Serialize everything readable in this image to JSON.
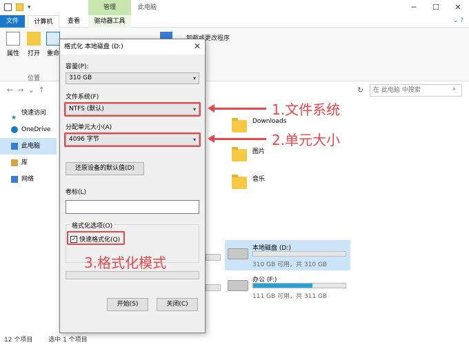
{
  "explorer": {
    "title": "此电脑",
    "contextual_tab": "管理",
    "ribbon_tabs": [
      "文件",
      "计算机",
      "查看",
      "驱动器工具"
    ],
    "ribbon_buttons": [
      "属性",
      "打开",
      "重命"
    ],
    "ribbon_group": "位置",
    "ribbon_right_text": "卸载或更改程序",
    "ribbon_right_text2": "性",
    "search_placeholder": "在 此电脑 中搜索",
    "nav_items": [
      {
        "label": "快速访问"
      },
      {
        "label": "OneDrive"
      },
      {
        "label": "此电脑"
      },
      {
        "label": "库"
      },
      {
        "label": "网络"
      }
    ],
    "folders": [
      {
        "label": "Downloads"
      },
      {
        "label": "图片"
      },
      {
        "label": "音乐"
      }
    ],
    "drives": [
      {
        "name": "本地磁盘 (D:)",
        "size": "310 GB 可用，共 310 GB",
        "used_fraction": 0.0
      },
      {
        "name": "办公 (F:)",
        "size": "111 GB 可用，共 311 GB",
        "used_fraction": 0.64
      }
    ],
    "status": {
      "count": "12 个项目",
      "selected": "选中 1 个项目"
    }
  },
  "dialog": {
    "title": "格式化 本地磁盘 (D:)",
    "capacity_label": "容量(P):",
    "capacity_value": "310 GB",
    "fs_label": "文件系统(F)",
    "fs_value": "NTFS (默认)",
    "unit_label": "分配单元大小(A)",
    "unit_value": "4096 字节",
    "restore_button": "还原设备的默认值(D)",
    "volume_label": "卷标(L)",
    "volume_value": "",
    "options_label": "格式化选项(O)",
    "quick_format": "快速格式化(Q)",
    "quick_format_checked": true,
    "start_button": "开始(S)",
    "close_button": "关闭(C)"
  },
  "annotations": {
    "a1": "1.文件系统",
    "a2": "2.单元大小",
    "a3": "3.格式化模式"
  },
  "colors": {
    "accent": "#1979ca",
    "highlight": "#e8474b",
    "tool_tab": "#c8e6b0"
  }
}
